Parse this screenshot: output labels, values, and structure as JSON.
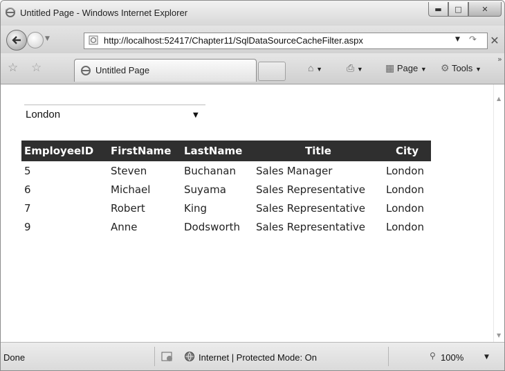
{
  "window": {
    "title": "Untitled Page - Windows Internet Explorer"
  },
  "address": {
    "url": "http://localhost:52417/Chapter11/SqlDataSourceCacheFilter.aspx"
  },
  "toolbar": {
    "tab_label": "Untitled Page",
    "page_label": "Page",
    "tools_label": "Tools"
  },
  "content": {
    "city_select": {
      "selected": "London"
    },
    "grid": {
      "columns": [
        "EmployeeID",
        "FirstName",
        "LastName",
        "Title",
        "City"
      ],
      "rows": [
        [
          "5",
          "Steven",
          "Buchanan",
          "Sales Manager",
          "London"
        ],
        [
          "6",
          "Michael",
          "Suyama",
          "Sales Representative",
          "London"
        ],
        [
          "7",
          "Robert",
          "King",
          "Sales Representative",
          "London"
        ],
        [
          "9",
          "Anne",
          "Dodsworth",
          "Sales Representative",
          "London"
        ]
      ]
    }
  },
  "statusbar": {
    "status": "Done",
    "zone": "Internet | Protected Mode: On",
    "zoom": "100%"
  },
  "colors": {
    "grid_header_bg": "#2f2f2f",
    "grid_header_fg": "#ffffff"
  }
}
